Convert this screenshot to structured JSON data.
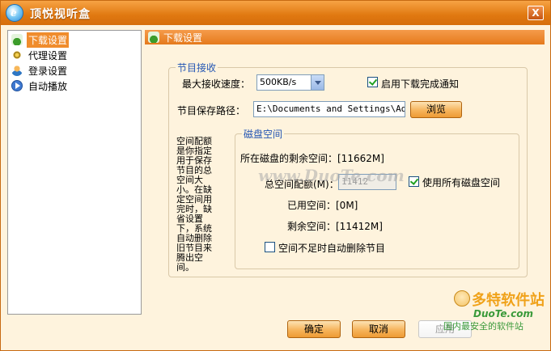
{
  "window": {
    "title": "顶悦视听盒",
    "close_label": "X"
  },
  "sidebar": {
    "items": [
      {
        "label": "下载设置",
        "icon": "download-icon",
        "active": true
      },
      {
        "label": "代理设置",
        "icon": "gear-icon",
        "active": false
      },
      {
        "label": "登录设置",
        "icon": "user-icon",
        "active": false
      },
      {
        "label": "自动播放",
        "icon": "play-icon",
        "active": false
      }
    ]
  },
  "panel": {
    "header": "下载设置",
    "receive_group": {
      "legend": "节目接收",
      "max_speed_label": "最大接收速度：",
      "max_speed_value": "500KB/s",
      "notify_label": "启用下载完成通知",
      "notify_checked": true,
      "path_label": "节目保存路径：",
      "path_value": "E:\\Documents and Settings\\Admi",
      "browse_label": "浏览"
    },
    "note": "空间配额是你指定用于保存节目的总空间大小。在缺定空间用完时，缺省设置下，系统自动删除旧节目来腾出空间。",
    "disk_group": {
      "legend": "磁盘空间",
      "free_label": "所在磁盘的剩余空间：[11662M]",
      "quota_label": "总空间配额(M)：",
      "quota_value": "11412",
      "use_all_label": "使用所有磁盘空间",
      "use_all_checked": true,
      "used_label": "已用空间：[0M]",
      "remain_label": "剩余空间：[11412M]",
      "auto_delete_label": "空间不足时自动删除节目",
      "auto_delete_checked": false
    }
  },
  "footer": {
    "ok_label": "确定",
    "cancel_label": "取消",
    "apply_label": "应用"
  },
  "watermark": {
    "center": "www.DuoTe.com",
    "logo_main": "多特软件站",
    "logo_url": "DuoTe.com",
    "logo_slogan": "国内最安全的软件站"
  },
  "colors": {
    "title_bar": "#e07810",
    "background": "#fef3dd",
    "accent": "#f08c2c",
    "group_legend": "#2456b3"
  }
}
